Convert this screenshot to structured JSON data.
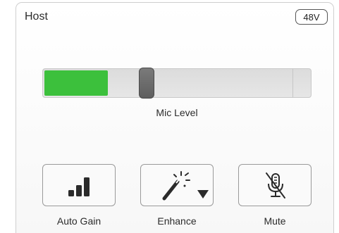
{
  "panel": {
    "title": "Host",
    "phantom_power_label": "48V"
  },
  "mic_level": {
    "label": "Mic Level",
    "meter_fill_fraction": 0.24,
    "slider_value_fraction": 0.38,
    "meter_color": "#3cc03c"
  },
  "buttons": [
    {
      "label": "Auto Gain",
      "icon": "signal-bars-icon"
    },
    {
      "label": "Enhance",
      "icon": "magic-wand-icon",
      "has_dropdown": true
    },
    {
      "label": "Mute",
      "icon": "microphone-off-icon"
    }
  ]
}
